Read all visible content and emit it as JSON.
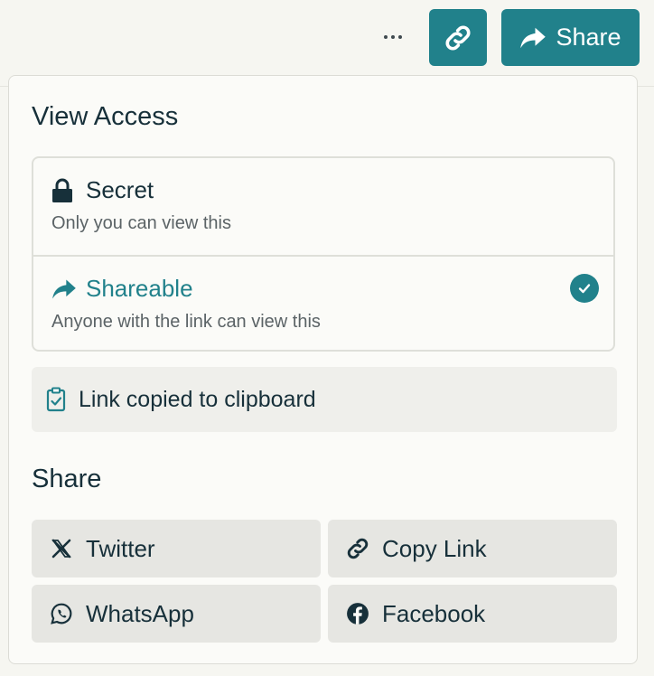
{
  "toolbar": {
    "more_icon": "ellipsis-icon",
    "link_icon": "link-icon",
    "share_label": "Share",
    "accent": "#21818b"
  },
  "panel": {
    "view_access_title": "View Access",
    "options": [
      {
        "title": "Secret",
        "description": "Only you can view this",
        "icon": "lock-icon",
        "selected": false
      },
      {
        "title": "Shareable",
        "description": "Anyone with the link can view this",
        "icon": "share-arrow-icon",
        "selected": true
      }
    ],
    "toast": {
      "text": "Link copied to clipboard",
      "icon": "clipboard-check-icon"
    },
    "share_title": "Share",
    "share_buttons": [
      {
        "label": "Twitter",
        "icon": "x-twitter-icon"
      },
      {
        "label": "Copy Link",
        "icon": "link-icon"
      },
      {
        "label": "WhatsApp",
        "icon": "whatsapp-icon"
      },
      {
        "label": "Facebook",
        "icon": "facebook-icon"
      }
    ]
  }
}
